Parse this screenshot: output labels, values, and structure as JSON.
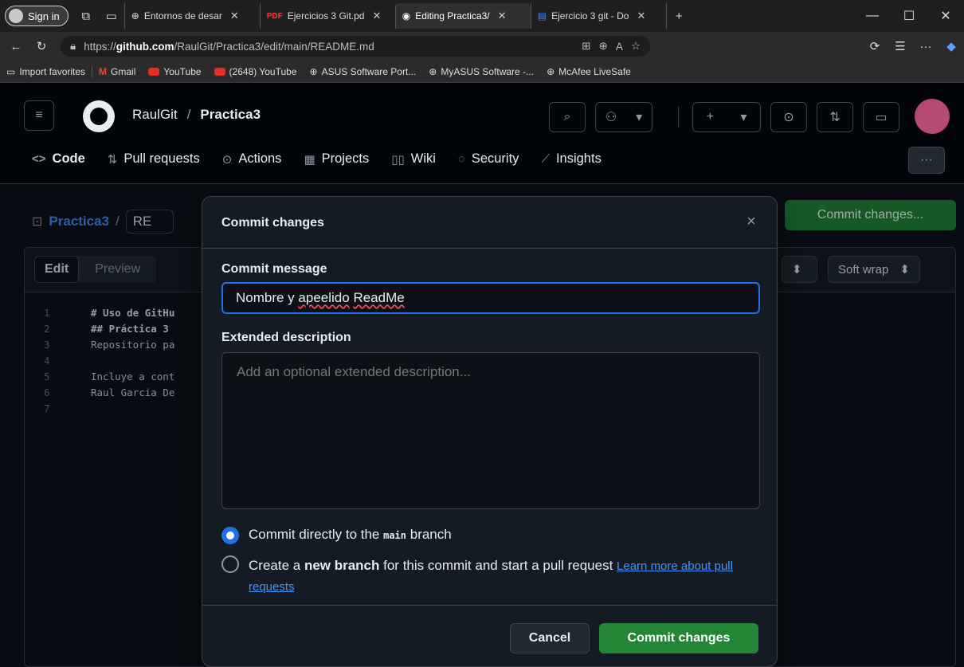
{
  "browser": {
    "signin": "Sign in",
    "tabs": [
      {
        "title": "Entornos de desar"
      },
      {
        "title": "Ejercicios 3 Git.pd"
      },
      {
        "title": "Editing Practica3/"
      },
      {
        "title": "Ejercicio 3 git - Do"
      }
    ],
    "url_prefix": "https://",
    "url_domain": "github.com",
    "url_path": "/RaulGit/Practica3/edit/main/README.md",
    "favorites": [
      "Import favorites",
      "Gmail",
      "YouTube",
      "(2648) YouTube",
      "ASUS Software Port...",
      "MyASUS Software -...",
      "McAfee LiveSafe"
    ]
  },
  "github": {
    "owner": "RaulGit",
    "separator": "/",
    "repo": "Practica3",
    "nav": [
      "Code",
      "Pull requests",
      "Actions",
      "Projects",
      "Wiki",
      "Security",
      "Insights"
    ],
    "more": "···",
    "crumb_repo": "Practica3",
    "crumb_sep": "/",
    "crumb_file": "RE",
    "commit_top": "Commit changes...",
    "editor": {
      "edit_tab": "Edit",
      "preview_tab": "Preview",
      "soft_wrap": "Soft wrap",
      "lines": [
        {
          "n": "1",
          "t": "# Uso de GitHu",
          "bold": true
        },
        {
          "n": "2",
          "t": "## Práctica 3",
          "bold": true
        },
        {
          "n": "3",
          "t": "Repositorio pa",
          "bold": false
        },
        {
          "n": "4",
          "t": "",
          "bold": false
        },
        {
          "n": "5",
          "t": "Incluye a cont",
          "bold": false
        },
        {
          "n": "6",
          "t": "Raul Garcia De",
          "bold": false
        },
        {
          "n": "7",
          "t": "",
          "bold": false
        }
      ]
    }
  },
  "modal": {
    "title": "Commit changes",
    "close": "×",
    "message_label": "Commit message",
    "message_pre": "Nombre y ",
    "message_typo": "apeelido",
    "message_mid": " ",
    "message_typo2": "ReadMe",
    "desc_label": "Extended description",
    "desc_placeholder": "Add an optional extended description...",
    "opt1_pre": "Commit directly to the ",
    "opt1_branch": "main",
    "opt1_post": " branch",
    "opt2_pre": "Create a ",
    "opt2_bold": "new branch",
    "opt2_post": " for this commit and start a pull request ",
    "opt2_link": "Learn more about pull requests",
    "cancel": "Cancel",
    "commit": "Commit changes"
  }
}
